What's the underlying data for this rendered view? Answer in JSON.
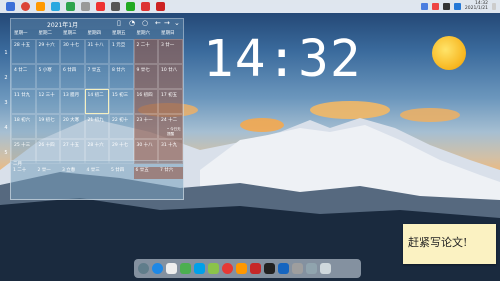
{
  "taskbar": {
    "time": "14:32",
    "date": "2021/1/21"
  },
  "calendar": {
    "month_title": "2021年1月",
    "weekdays": [
      "星期一",
      "星期二",
      "星期三",
      "星期四",
      "星期五",
      "星期六",
      "星期日"
    ],
    "week_numbers": [
      "1",
      "2",
      "3",
      "4",
      "5"
    ],
    "rows": [
      [
        "28 十五",
        "29 十六",
        "30 十七",
        "31 十八",
        "1 元旦",
        "2 二十",
        "3 廿一"
      ],
      [
        "4 廿二",
        "5 小寒",
        "6 廿四",
        "7 廿五",
        "8 廿六",
        "9 廿七",
        "10 廿八"
      ],
      [
        "11 廿九",
        "12 三十",
        "13 腊月",
        "14 初二",
        "15 初三",
        "16 初四",
        "17 初五"
      ],
      [
        "18 初六",
        "19 初七",
        "20 大寒",
        "21 初九",
        "22 初十",
        "23 十一",
        "24 十二"
      ],
      [
        "25 十三",
        "26 十四",
        "27 十五",
        "28 十六",
        "29 十七",
        "30 十八",
        "31 十九"
      ]
    ],
    "today_label": "21 初九",
    "lower_label": "二月",
    "lower_row": [
      "1 二十",
      "2 廿一",
      "3 立春",
      "4 廿三",
      "5 廿四",
      "6 廿五",
      "7 廿六"
    ],
    "note": "• 今日无提醒"
  },
  "clock": {
    "time": "14:32"
  },
  "note": {
    "text": "赶紧写论文!"
  },
  "colors": {
    "taskbar": "#eef2f8",
    "weekend": "#96503c",
    "sun": "#f7b51e",
    "note": "#fbf2c2"
  }
}
